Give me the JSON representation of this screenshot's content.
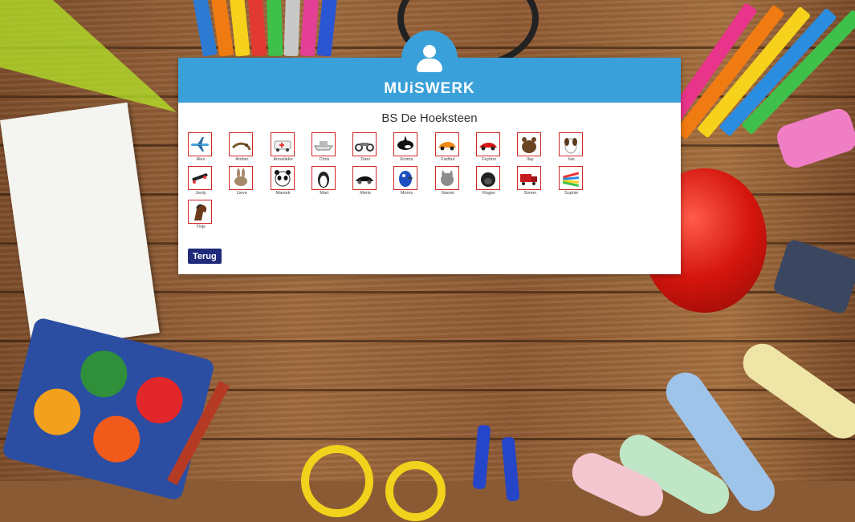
{
  "brand": "MUiSWERK",
  "school_name": "BS De Hoeksteen",
  "back_label": "Terug",
  "colors": {
    "header_blue": "#3aa0d9",
    "thumb_border_red": "#d22626",
    "button_navy": "#1f2b7a"
  },
  "pupils": [
    {
      "name": "Alex",
      "icon": "airplane-icon"
    },
    {
      "name": "Amber",
      "icon": "lizard-icon"
    },
    {
      "name": "Annalieke",
      "icon": "ambulance-icon"
    },
    {
      "name": "Chris",
      "icon": "boat-icon"
    },
    {
      "name": "Dani",
      "icon": "motorcycle-icon"
    },
    {
      "name": "Emma",
      "icon": "orca-icon"
    },
    {
      "name": "Fadhul",
      "icon": "sports-car-orange-icon"
    },
    {
      "name": "Feylinn",
      "icon": "sports-car-red-icon"
    },
    {
      "name": "Ilay",
      "icon": "bear-icon"
    },
    {
      "name": "Isis",
      "icon": "dog-icon"
    },
    {
      "name": "Jordy",
      "icon": "skateboard-icon"
    },
    {
      "name": "Lieve",
      "icon": "rabbit-icon"
    },
    {
      "name": "Maniek",
      "icon": "panda-icon"
    },
    {
      "name": "Mart",
      "icon": "penguin-icon"
    },
    {
      "name": "Merle",
      "icon": "black-car-icon"
    },
    {
      "name": "Morris",
      "icon": "parrot-icon"
    },
    {
      "name": "Naomi",
      "icon": "cat-icon"
    },
    {
      "name": "Rogier",
      "icon": "gorilla-icon"
    },
    {
      "name": "Simon",
      "icon": "truck-icon"
    },
    {
      "name": "Sophie",
      "icon": "color-pencils-icon"
    },
    {
      "name": "Thijs",
      "icon": "horse-icon"
    }
  ]
}
